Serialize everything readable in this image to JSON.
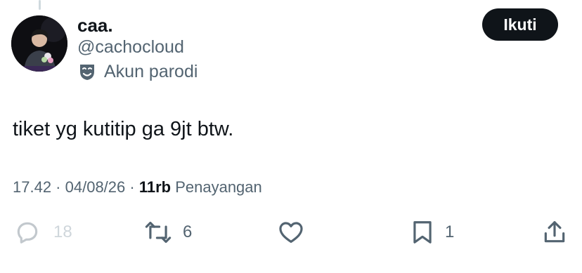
{
  "header": {
    "display_name": "caa.",
    "handle": "@cachocloud",
    "parody_label": "Akun parodi",
    "follow_label": "Ikuti"
  },
  "tweet": {
    "text": "tiket yg kutitip ga 9jt btw."
  },
  "meta": {
    "time": "17.42",
    "separator1": " · ",
    "date": "04/08/26",
    "separator2": " · ",
    "views_count": "11rb",
    "views_label": " Penayangan"
  },
  "actions": {
    "reply_count": "18",
    "retweet_count": "6",
    "bookmark_count": "1"
  },
  "icons": {
    "avatar": "profile-photo",
    "parody": "parody-mask-icon",
    "reply": "reply-icon",
    "retweet": "retweet-icon",
    "like": "heart-icon",
    "bookmark": "bookmark-icon",
    "share": "share-icon"
  },
  "colors": {
    "text_primary": "#0f1419",
    "text_secondary": "#536471",
    "button_bg": "#0f1419",
    "button_text": "#ffffff"
  }
}
